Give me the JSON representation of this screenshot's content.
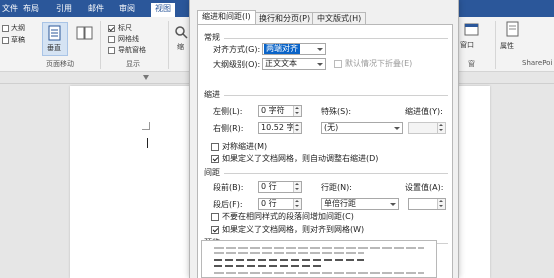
{
  "ribbon": {
    "tabs": [
      "文件",
      "布局",
      "引用",
      "邮件",
      "审阅",
      "视图"
    ],
    "active_tab": "视图",
    "checkbox_1": "大纲",
    "checkbox_2": "草稿",
    "vertical_button": "垂直",
    "group_page_movement": "页面移动",
    "show_ruler": "标尺",
    "show_gridlines": "网格线",
    "show_nav_pane": "导航窗格",
    "group_show": "显示",
    "zoom_partial": "缩",
    "right_cut_1": "窗口",
    "right_cut_2": "窗",
    "right_label": "属性",
    "share_point": "SharePoi"
  },
  "dialog": {
    "tabs": {
      "indent_spacing": "缩进和间距(I)",
      "line_page_breaks": "换行和分页(P)",
      "asian_typography": "中文版式(H)"
    },
    "general": {
      "section": "常规",
      "alignment_label": "对齐方式(G):",
      "alignment_value": "两端对齐",
      "outline_label": "大纲级别(O):",
      "outline_value": "正文文本",
      "collapse_label": "默认情况下折叠(E)"
    },
    "indent": {
      "section": "缩进",
      "left_label": "左侧(L):",
      "left_value": "0 字符",
      "right_label": "右侧(R):",
      "right_value": "10.52 字",
      "special_label": "特殊(S):",
      "special_value": "(无)",
      "by_label": "缩进值(Y):",
      "mirror_label": "对称缩进(M)",
      "auto_adjust_label": "如果定义了文档网格，则自动调整右缩进(D)"
    },
    "spacing": {
      "section": "间距",
      "before_label": "段前(B):",
      "before_value": "0 行",
      "after_label": "段后(F):",
      "after_value": "0 行",
      "line_spacing_label": "行距(N):",
      "line_spacing_value": "单倍行距",
      "at_label": "设置值(A):",
      "no_space_label": "不要在相同样式的段落间增加间距(C)",
      "snap_grid_label": "如果定义了文档网格，则对齐到网格(W)"
    },
    "preview": {
      "section": "预览"
    }
  },
  "colors": {
    "ribbon_blue": "#2b579a",
    "selection_blue": "#0a64c8"
  }
}
